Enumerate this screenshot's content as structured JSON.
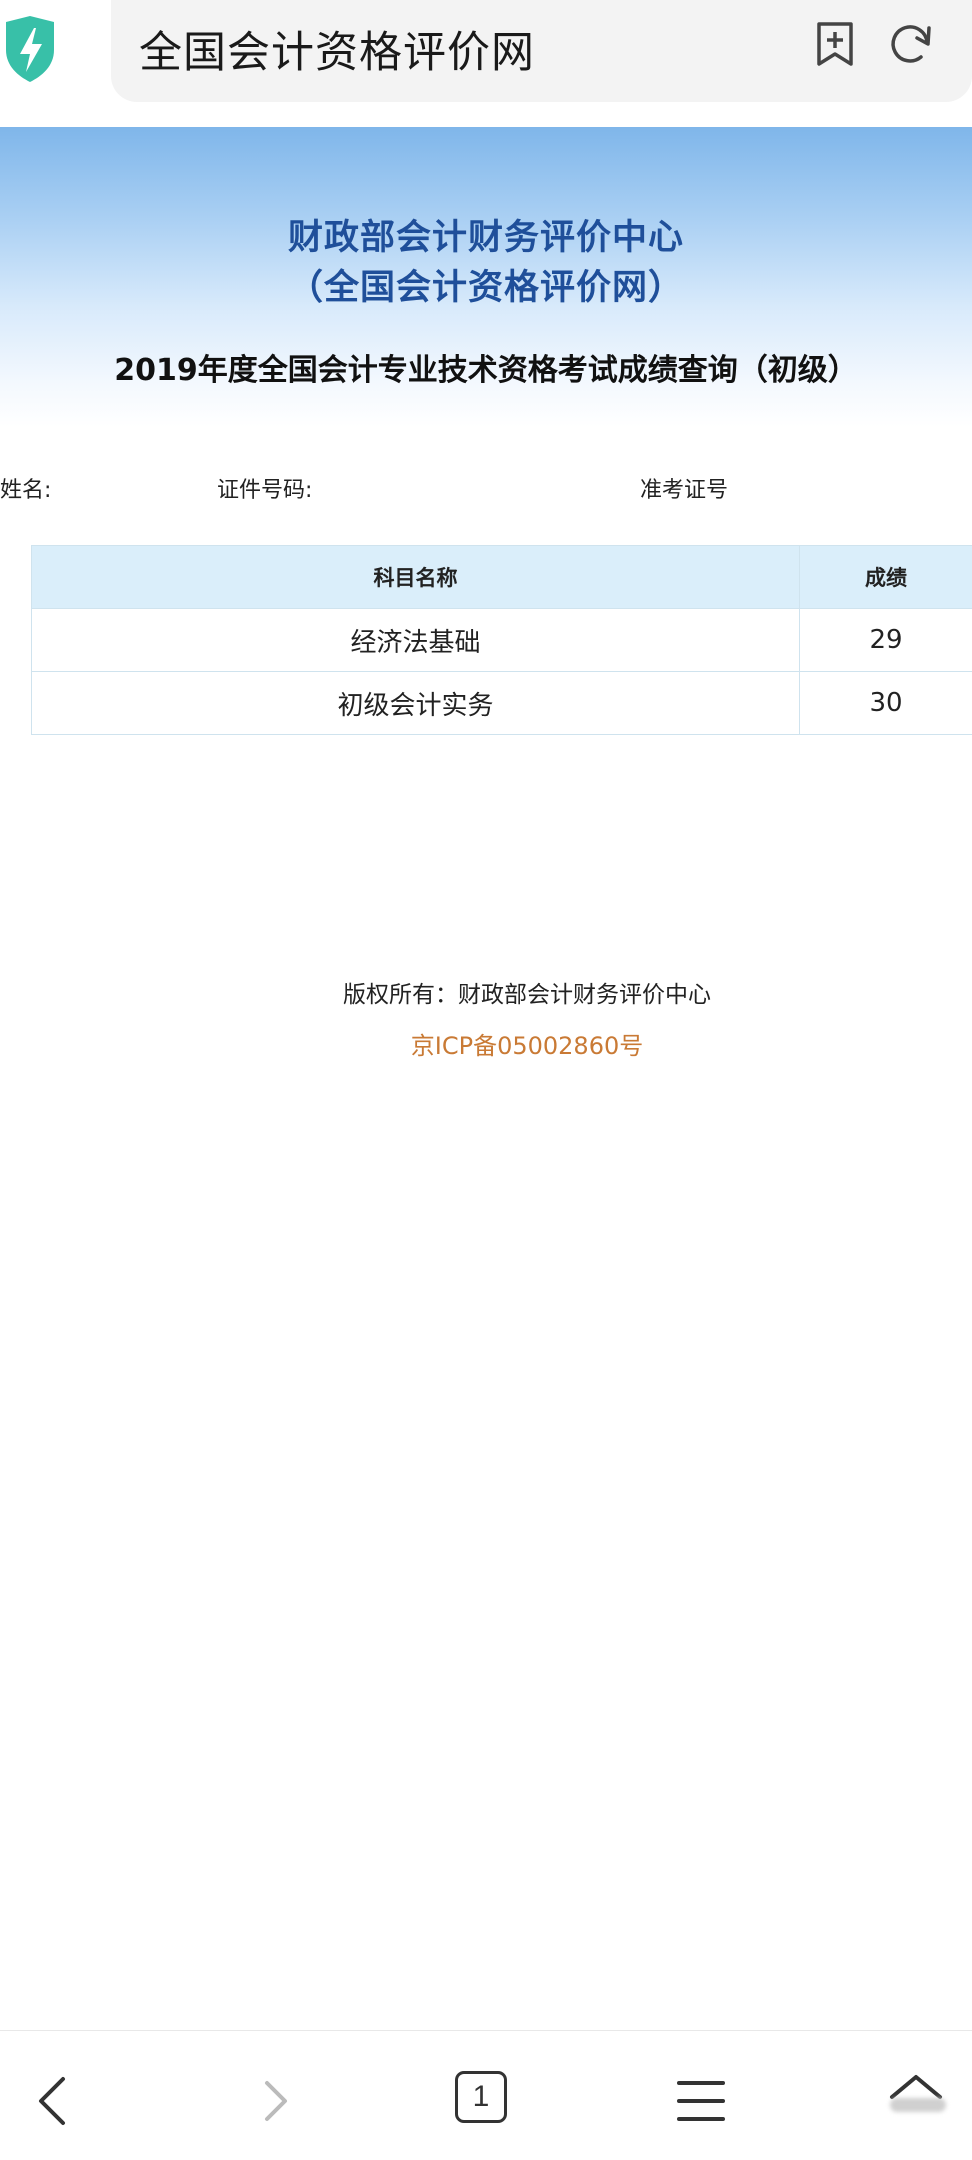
{
  "browser": {
    "url_title": "全国会计资格评价网",
    "shield_icon": "lightning-shield-icon",
    "bookmark_icon": "add-bookmark-icon",
    "refresh_icon": "refresh-icon",
    "accent_color": "#38c0a8"
  },
  "banner": {
    "org_line1": "财政部会计财务评价中心",
    "org_line2": "（全国会计资格评价网）",
    "exam_title": "2019年度全国会计专业技术资格考试成绩查询（初级）"
  },
  "info": {
    "name_label": "姓名:",
    "id_label": "证件号码:",
    "exam_no_label": "准考证号"
  },
  "scores": {
    "headers": [
      "科目名称",
      "成绩"
    ],
    "rows": [
      {
        "subject": "经济法基础",
        "score": "29"
      },
      {
        "subject": "初级会计实务",
        "score": "30"
      }
    ]
  },
  "footer": {
    "copyright": "版权所有：财政部会计财务评价中心",
    "icp": "京ICP备05002860号",
    "icp_color": "#c97a35"
  },
  "navbar": {
    "tab_count": "1",
    "icons": [
      "back-icon",
      "forward-icon",
      "tabs-icon",
      "menu-icon",
      "home-icon"
    ]
  }
}
